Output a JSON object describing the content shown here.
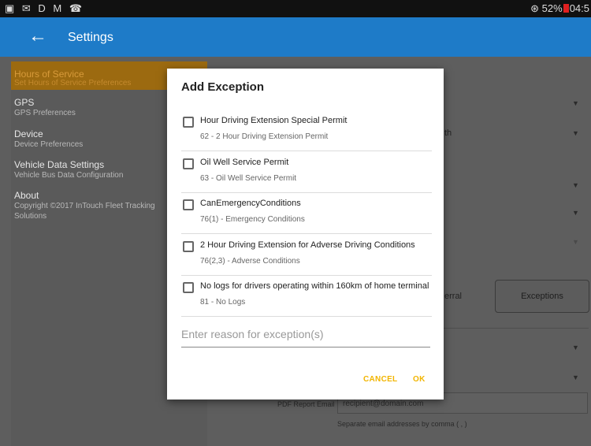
{
  "status_bar": {
    "left_icons": "▣ ✉ D M ☎",
    "signal": "⊛",
    "battery_percent": "52%",
    "time": "04:5"
  },
  "app_bar": {
    "back_icon": "arrow-left-icon",
    "title": "Settings"
  },
  "sidebar": {
    "items": [
      {
        "title": "Hours of Service",
        "subtitle": "Set Hours of Service Preferences",
        "active": true
      },
      {
        "title": "GPS",
        "subtitle": "GPS Preferences"
      },
      {
        "title": "Device",
        "subtitle": "Device Preferences"
      },
      {
        "title": "Vehicle Data Settings",
        "subtitle": "Vehicle Bus Data Configuration"
      },
      {
        "title": "About",
        "subtitle": "Copyright ©2017 InTouch Fleet Tracking Solutions"
      }
    ]
  },
  "background": {
    "partial_text_th": "th",
    "partial_text_erral": "erral",
    "exceptions_button": "Exceptions",
    "pdf_email_label": "PDF Report Email",
    "pdf_email_value": "recipient@domain.com",
    "pdf_email_hint": "Separate email addresses by comma ( , )"
  },
  "dialog": {
    "title": "Add Exception",
    "options": [
      {
        "label": "Hour Driving Extension Special Permit",
        "sub": "62 - 2 Hour Driving Extension Permit",
        "checked": false
      },
      {
        "label": "Oil Well Service Permit",
        "sub": "63 - Oil Well Service Permit",
        "checked": false
      },
      {
        "label": "CanEmergencyConditions",
        "sub": "76(1) - Emergency Conditions",
        "checked": false
      },
      {
        "label": "2 Hour Driving Extension for Adverse Driving Conditions",
        "sub": "76(2,3) - Adverse Conditions",
        "checked": false
      },
      {
        "label": "No logs for drivers operating within 160km of home terminal",
        "sub": "81 - No Logs",
        "checked": false
      }
    ],
    "reason_placeholder": "Enter reason for exception(s)",
    "reason_value": "",
    "cancel_label": "CANCEL",
    "ok_label": "OK"
  },
  "colors": {
    "app_bar": "#1e7bc8",
    "accent": "#f2b500",
    "active_sidebar": "#9c6a10"
  }
}
